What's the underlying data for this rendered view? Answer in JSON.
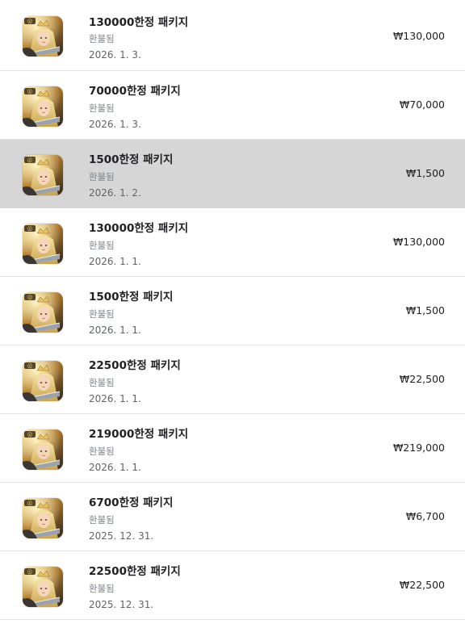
{
  "app_icon": "game-app-icon",
  "purchases": [
    {
      "title": "130000한정 패키지",
      "status": "환불됨",
      "date": "2026. 1. 3.",
      "price": "₩130,000",
      "selected": false
    },
    {
      "title": "70000한정 패키지",
      "status": "환불됨",
      "date": "2026. 1. 3.",
      "price": "₩70,000",
      "selected": false
    },
    {
      "title": "1500한정 패키지",
      "status": "환불됨",
      "date": "2026. 1. 2.",
      "price": "₩1,500",
      "selected": true
    },
    {
      "title": "130000한정 패키지",
      "status": "환불됨",
      "date": "2026. 1. 1.",
      "price": "₩130,000",
      "selected": false
    },
    {
      "title": "1500한정 패키지",
      "status": "환불됨",
      "date": "2026. 1. 1.",
      "price": "₩1,500",
      "selected": false
    },
    {
      "title": "22500한정 패키지",
      "status": "환불됨",
      "date": "2026. 1. 1.",
      "price": "₩22,500",
      "selected": false
    },
    {
      "title": "219000한정 패키지",
      "status": "환불됨",
      "date": "2026. 1. 1.",
      "price": "₩219,000",
      "selected": false
    },
    {
      "title": "6700한정 패키지",
      "status": "환불됨",
      "date": "2025. 12. 31.",
      "price": "₩6,700",
      "selected": false
    },
    {
      "title": "22500한정 패키지",
      "status": "환불됨",
      "date": "2025. 12. 31.",
      "price": "₩22,500",
      "selected": false
    }
  ]
}
